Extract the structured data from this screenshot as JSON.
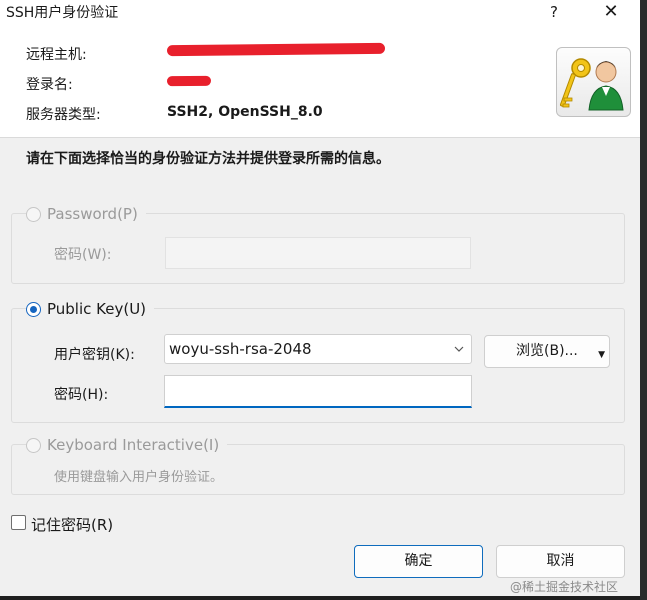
{
  "window": {
    "title": "SSH用户身份验证",
    "help_label": "?",
    "close_label": "✕"
  },
  "header": {
    "remote_host_label": "远程主机:",
    "login_name_label": "登录名:",
    "server_type_label": "服务器类型:",
    "server_type_value": "SSH2, OpenSSH_8.0",
    "redaction_color": "#e8202c",
    "logo_icon": "keys-user-icon"
  },
  "instruction": "请在下面选择恰当的身份验证方法并提供登录所需的信息。",
  "password_method": {
    "label": "Password(P)",
    "selected": false,
    "enabled": false,
    "password_label": "密码(W):"
  },
  "publickey_method": {
    "label": "Public Key(U)",
    "selected": true,
    "user_key_label": "用户密钥(K):",
    "user_key_value": "woyu-ssh-rsa-2048",
    "browse_label": "浏览(B)...",
    "password_label": "密码(H):"
  },
  "keyboard_method": {
    "label": "Keyboard Interactive(I)",
    "selected": false,
    "enabled": false,
    "description": "使用键盘输入用户身份验证。"
  },
  "remember_password": {
    "label": "记住密码(R)",
    "checked": false
  },
  "buttons": {
    "ok_label": "确定",
    "cancel_label": "取消"
  },
  "watermark": "@稀土掘金技术社区",
  "colors": {
    "accent": "#0067c0",
    "dialog_bg": "#f0f0f0"
  }
}
